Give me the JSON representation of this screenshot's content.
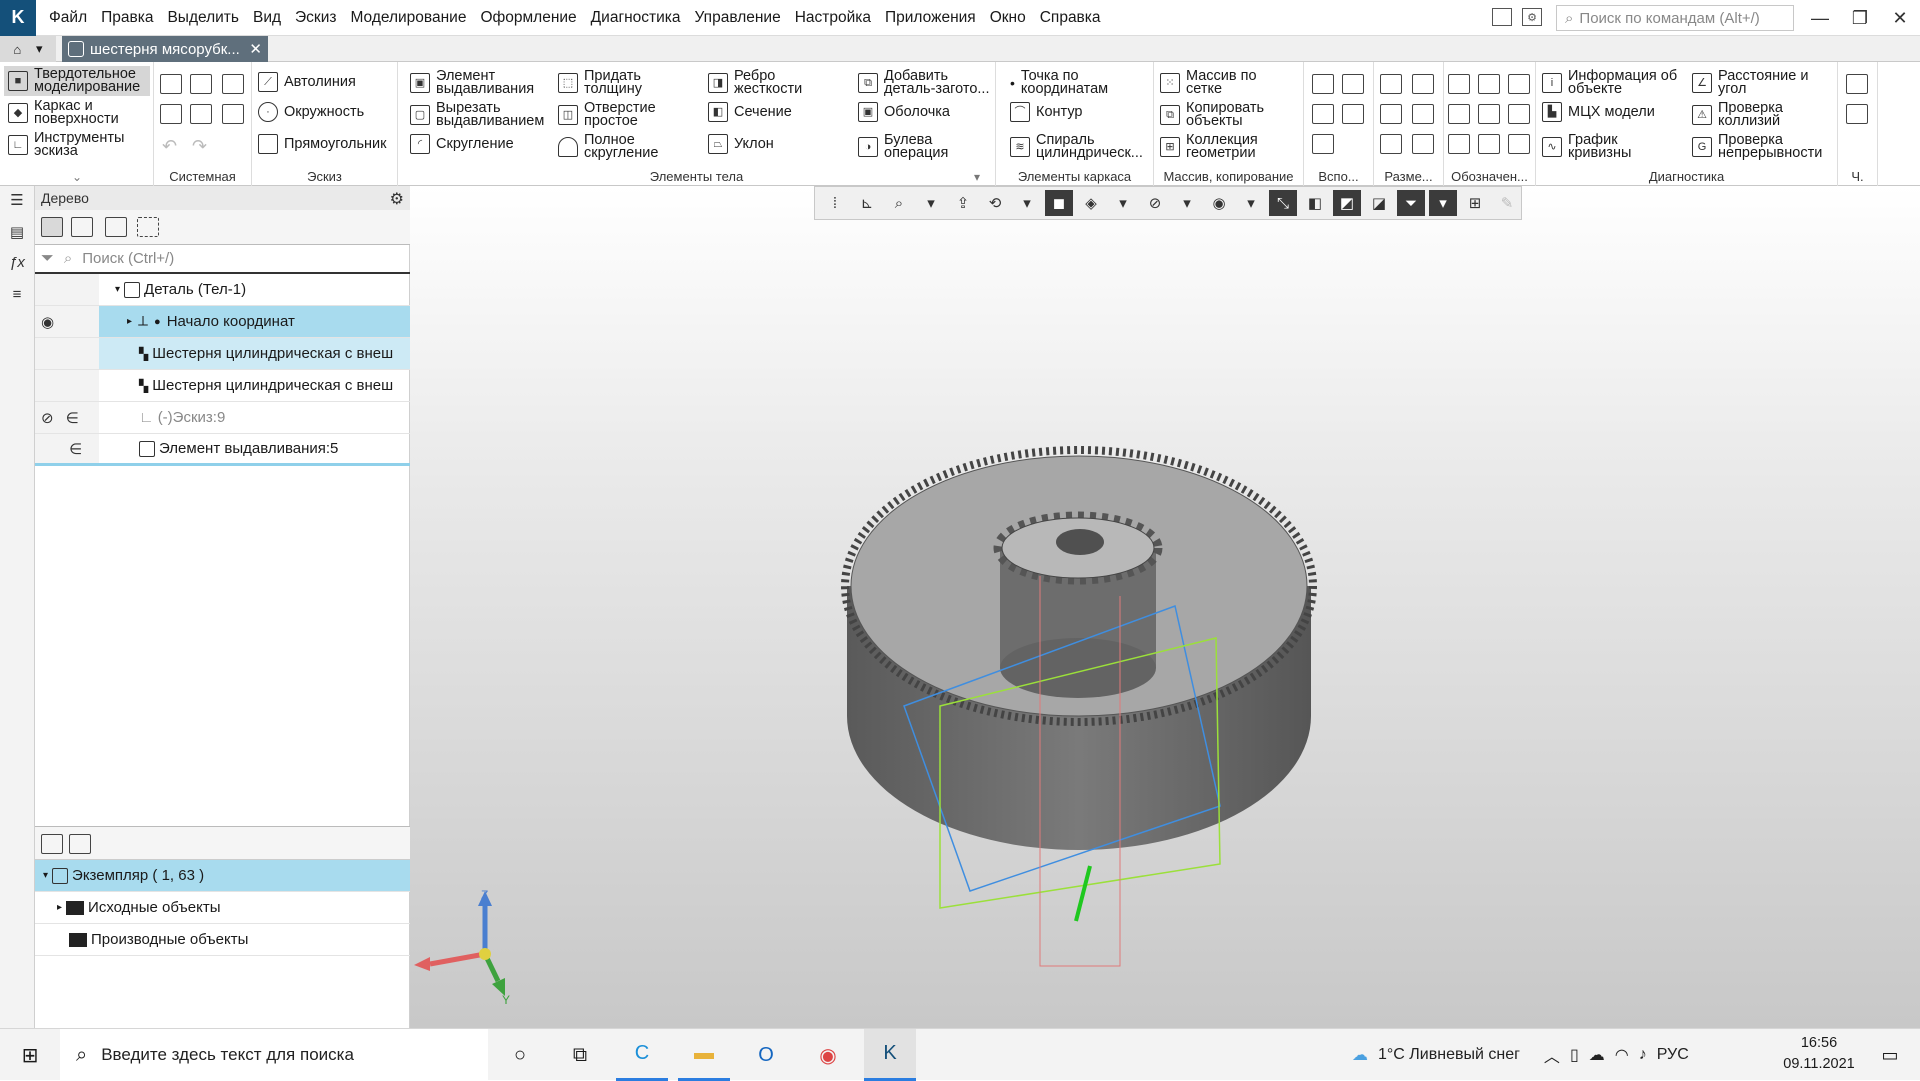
{
  "menubar": {
    "logo": "K",
    "items": [
      "Файл",
      "Правка",
      "Выделить",
      "Вид",
      "Эскиз",
      "Моделирование",
      "Оформление",
      "Диагностика",
      "Управление",
      "Настройка",
      "Приложения",
      "Окно",
      "Справка"
    ],
    "command_search_placeholder": "Поиск по командам (Alt+/)"
  },
  "tabs": {
    "document_title": "шестерня мясорубк...",
    "close_glyph": "✕"
  },
  "ribbon": {
    "modes": [
      "Твердотельное моделирование",
      "Каркас и поверхности",
      "Инструменты эскиза"
    ],
    "groups": {
      "system": "Системная",
      "sketch": "Эскиз",
      "body": "Элементы тела",
      "frame": "Элементы каркаса",
      "array": "Массив, копирование",
      "aux": "Вспо...",
      "dims": "Разме...",
      "marks": "Обозначен...",
      "diag": "Диагностика",
      "ch": "Ч."
    },
    "sketch_buttons": [
      "Автолиния",
      "Окружность",
      "Прямоугольник"
    ],
    "body_buttons": [
      "Элемент выдавливания",
      "Вырезать выдавливанием",
      "Скругление",
      "Придать толщину",
      "Отверстие простое",
      "Полное скругление",
      "Ребро жесткости",
      "Сечение",
      "Уклон",
      "Добавить деталь-загото...",
      "Оболочка",
      "Булева операция"
    ],
    "frame_buttons": [
      "Точка по координатам",
      "Контур",
      "Спираль цилиндрическ..."
    ],
    "array_buttons": [
      "Массив по сетке",
      "Копировать объекты",
      "Коллекция геометрии"
    ],
    "diag_buttons": [
      "Информация об объекте",
      "МЦХ модели",
      "График кривизны",
      "Расстояние и угол",
      "Проверка коллизий",
      "Проверка непрерывности"
    ]
  },
  "tree": {
    "title": "Дерево",
    "search_placeholder": "Поиск (Ctrl+/)",
    "rows": [
      {
        "label": "Деталь (Тел-1)"
      },
      {
        "label": "Начало координат"
      },
      {
        "label": "Шестерня цилиндрическая с внеш"
      },
      {
        "label": "Шестерня цилиндрическая с внеш"
      },
      {
        "label": "(-)Эскиз:9"
      },
      {
        "label": "Элемент выдавливания:5"
      }
    ],
    "lower_rows": [
      {
        "label": "Экземпляр ( 1, 63 )"
      },
      {
        "label": "Исходные объекты"
      },
      {
        "label": "Производные объекты"
      }
    ]
  },
  "axes": {
    "z": "Z",
    "y": "Y"
  },
  "taskbar": {
    "search_placeholder": "Введите здесь текст для поиска",
    "weather": "1°C  Ливневый снег",
    "language": "РУС",
    "time": "16:56",
    "date": "09.11.2021"
  }
}
